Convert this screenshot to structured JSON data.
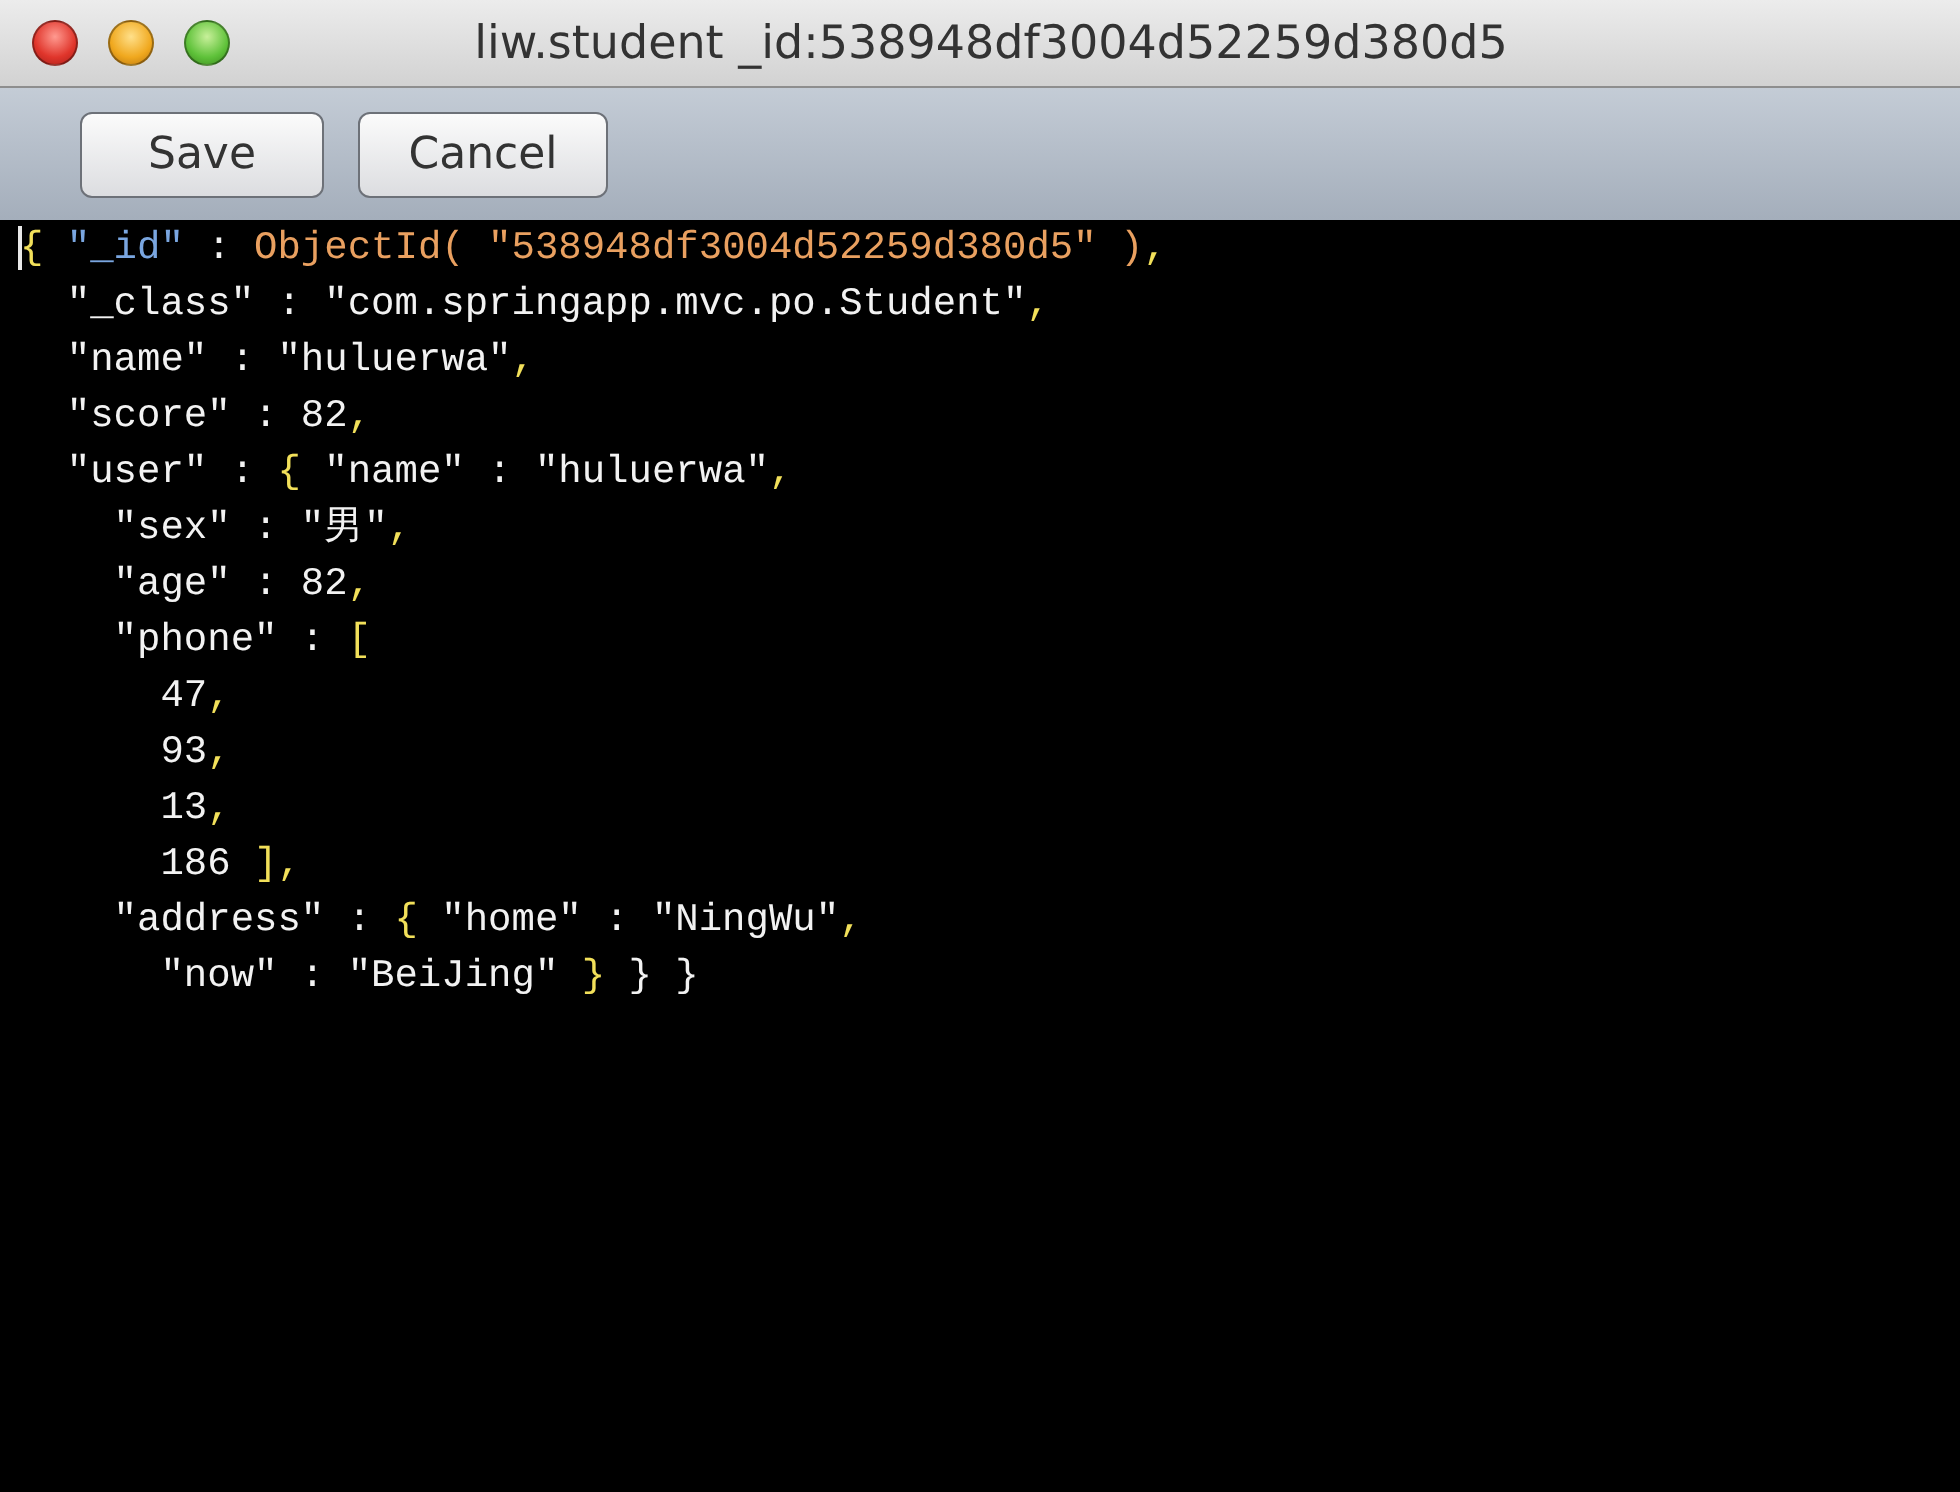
{
  "window": {
    "title": "liw.student _id:538948df3004d52259d380d5"
  },
  "buttons": [
    "Save",
    "Cancel"
  ],
  "editor": {
    "lines": [
      [
        {
          "kind": "punct",
          "text": "{"
        },
        {
          "kind": "id",
          "text": " \"_id\""
        },
        {
          "kind": "text",
          "text": " : "
        },
        {
          "kind": "oid",
          "text": "ObjectId( \"538948df3004d52259d380d5\" )"
        },
        {
          "kind": "punct",
          "text": ","
        }
      ],
      [
        {
          "kind": "text",
          "text": "  \"_class\" : \"com.springapp.mvc.po.Student\""
        },
        {
          "kind": "punct",
          "text": ","
        }
      ],
      [
        {
          "kind": "text",
          "text": "  \"name\" : \"huluerwa\""
        },
        {
          "kind": "punct",
          "text": ","
        }
      ],
      [
        {
          "kind": "text",
          "text": "  \"score\" : 82"
        },
        {
          "kind": "punct",
          "text": ","
        }
      ],
      [
        {
          "kind": "text",
          "text": "  \"user\" : "
        },
        {
          "kind": "punct",
          "text": "{"
        },
        {
          "kind": "text",
          "text": " \"name\" : \"huluerwa\""
        },
        {
          "kind": "punct",
          "text": ","
        }
      ],
      [
        {
          "kind": "text",
          "text": "    \"sex\" : \"男\""
        },
        {
          "kind": "punct",
          "text": ","
        }
      ],
      [
        {
          "kind": "text",
          "text": "    \"age\" : 82"
        },
        {
          "kind": "punct",
          "text": ","
        }
      ],
      [
        {
          "kind": "text",
          "text": "    \"phone\" : "
        },
        {
          "kind": "punct",
          "text": "["
        }
      ],
      [
        {
          "kind": "text",
          "text": "      47"
        },
        {
          "kind": "punct",
          "text": ","
        }
      ],
      [
        {
          "kind": "text",
          "text": "      93"
        },
        {
          "kind": "punct",
          "text": ","
        }
      ],
      [
        {
          "kind": "text",
          "text": "      13"
        },
        {
          "kind": "punct",
          "text": ","
        }
      ],
      [
        {
          "kind": "text",
          "text": "      186 "
        },
        {
          "kind": "punct",
          "text": "],"
        }
      ],
      [
        {
          "kind": "text",
          "text": "    \"address\" : "
        },
        {
          "kind": "punct",
          "text": "{"
        },
        {
          "kind": "text",
          "text": " \"home\" : \"NingWu\""
        },
        {
          "kind": "punct",
          "text": ","
        }
      ],
      [
        {
          "kind": "text",
          "text": "      \"now\" : \"BeiJing\" "
        },
        {
          "kind": "punct",
          "text": "}"
        },
        {
          "kind": "text",
          "text": " } }"
        }
      ]
    ]
  }
}
